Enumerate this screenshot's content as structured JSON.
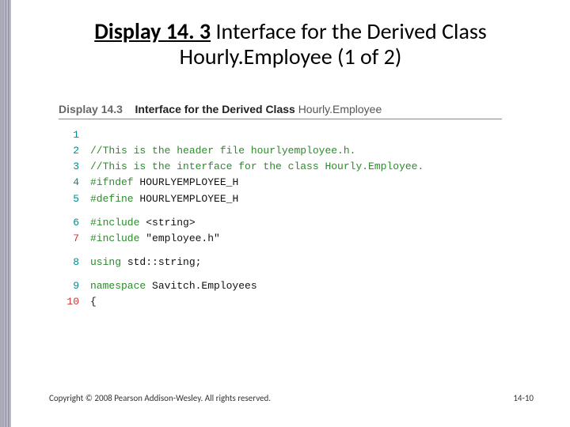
{
  "title": {
    "label_bold": "Display 14. 3",
    "label_rest": "  Interface for the Derived Class Hourly.Employee (1 of 2)"
  },
  "display_header": {
    "number": "Display 14.3",
    "title": "Interface for the Derived Class",
    "classname": "Hourly.Employee"
  },
  "code": {
    "lines": [
      {
        "n": "1",
        "gclass": "g-teal",
        "segs": []
      },
      {
        "n": "2",
        "gclass": "g-teal",
        "segs": [
          {
            "cls": "tok-comment",
            "t": "//This is the header file hourlyemployee.h."
          }
        ]
      },
      {
        "n": "3",
        "gclass": "g-teal",
        "segs": [
          {
            "cls": "tok-comment",
            "t": "//This is the interface for the class Hourly.Employee."
          }
        ]
      },
      {
        "n": "4",
        "gclass": "g-teal",
        "segs": [
          {
            "cls": "tok-pp",
            "t": "#ifndef "
          },
          {
            "cls": "tok-ppblack",
            "t": "HOURLYEMPLOYEE_H"
          }
        ]
      },
      {
        "n": "5",
        "gclass": "g-teal",
        "segs": [
          {
            "cls": "tok-pp",
            "t": "#define "
          },
          {
            "cls": "tok-ppblack",
            "t": "HOURLYEMPLOYEE_H"
          }
        ]
      },
      {
        "gap": true
      },
      {
        "n": "6",
        "gclass": "g-teal",
        "segs": [
          {
            "cls": "tok-pp",
            "t": "#include "
          },
          {
            "cls": "tok-str",
            "t": "<string>"
          }
        ]
      },
      {
        "n": "7",
        "gclass": "g-red",
        "segs": [
          {
            "cls": "tok-pp",
            "t": "#include "
          },
          {
            "cls": "tok-str",
            "t": "\"employee.h\""
          }
        ]
      },
      {
        "gap": true
      },
      {
        "n": "8",
        "gclass": "g-teal",
        "segs": [
          {
            "cls": "tok-kw",
            "t": "using "
          },
          {
            "cls": "tok-id",
            "t": "std::string;"
          }
        ]
      },
      {
        "gap": true
      },
      {
        "n": "9",
        "gclass": "g-teal",
        "segs": [
          {
            "cls": "tok-kw",
            "t": "namespace "
          },
          {
            "cls": "tok-ns",
            "t": "Savitch.Employees"
          }
        ]
      },
      {
        "n": "10",
        "gclass": "g-red",
        "segs": [
          {
            "cls": "tok-id",
            "t": "{"
          }
        ]
      }
    ]
  },
  "footer": "Copyright © 2008 Pearson Addison-Wesley. All rights reserved.",
  "pagenum": "14-10"
}
